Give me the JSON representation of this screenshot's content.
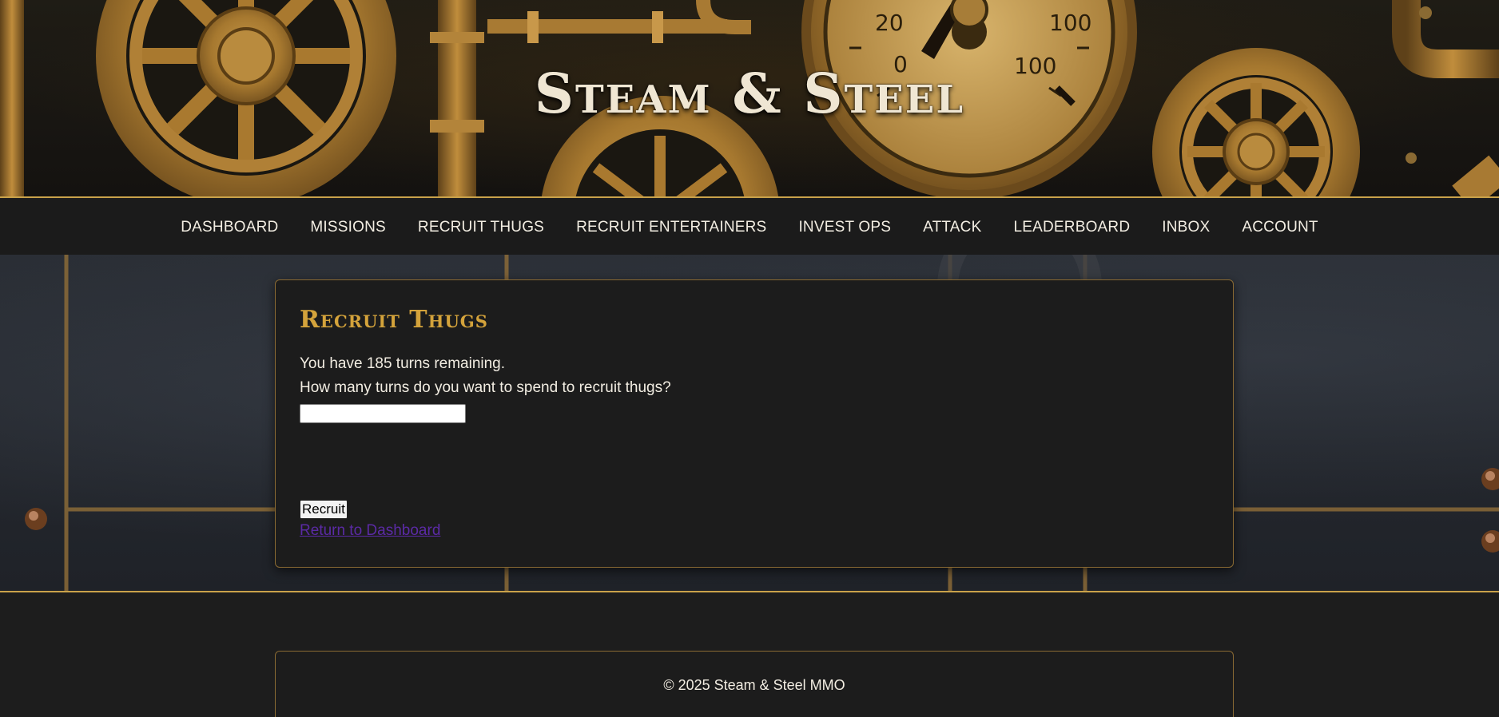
{
  "header": {
    "title": "Steam & Steel"
  },
  "nav": {
    "items": [
      "DASHBOARD",
      "MISSIONS",
      "RECRUIT THUGS",
      "RECRUIT ENTERTAINERS",
      "INVEST OPS",
      "ATTACK",
      "LEADERBOARD",
      "INBOX",
      "ACCOUNT"
    ]
  },
  "main": {
    "title": "Recruit Thugs",
    "turns_text": "You have 185 turns remaining.",
    "question": "How many turns do you want to spend to recruit thugs?",
    "input_value": "",
    "submit_label": "Recruit",
    "return_link": "Return to Dashboard"
  },
  "gauge": {
    "labels": [
      "20",
      "0",
      "100",
      "100"
    ]
  },
  "footer": {
    "text": "© 2025 Steam & Steel MMO"
  },
  "colors": {
    "accent": "#c9a24a",
    "title": "#d4a33b",
    "link": "#5b2aa5"
  }
}
